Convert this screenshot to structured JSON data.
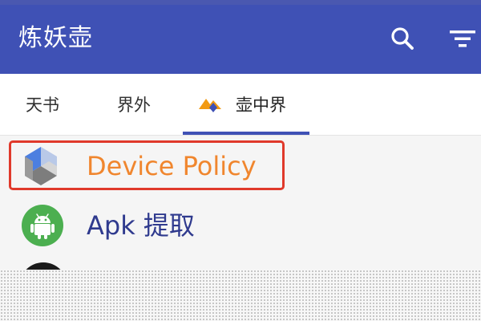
{
  "app": {
    "title": "炼妖壶",
    "colors": {
      "toolbar": "#3f51b5",
      "tab_indicator": "#3f51b5",
      "highlight_border": "#e0392b",
      "device_policy_label": "#f0862e",
      "apk_label": "#2f3a8e"
    }
  },
  "toolbar": {
    "icons": [
      "search-icon",
      "filter-icon"
    ]
  },
  "tabs": [
    {
      "label": "天书",
      "selected": false
    },
    {
      "label": "界外",
      "selected": false
    },
    {
      "label": "壶中界",
      "selected": true,
      "icon": "mountain-icon"
    }
  ],
  "list": {
    "items": [
      {
        "label": "Device Policy",
        "icon": "device-policy-icon",
        "highlighted": true
      },
      {
        "label": "Apk 提取",
        "icon": "android-icon",
        "highlighted": false
      }
    ]
  }
}
